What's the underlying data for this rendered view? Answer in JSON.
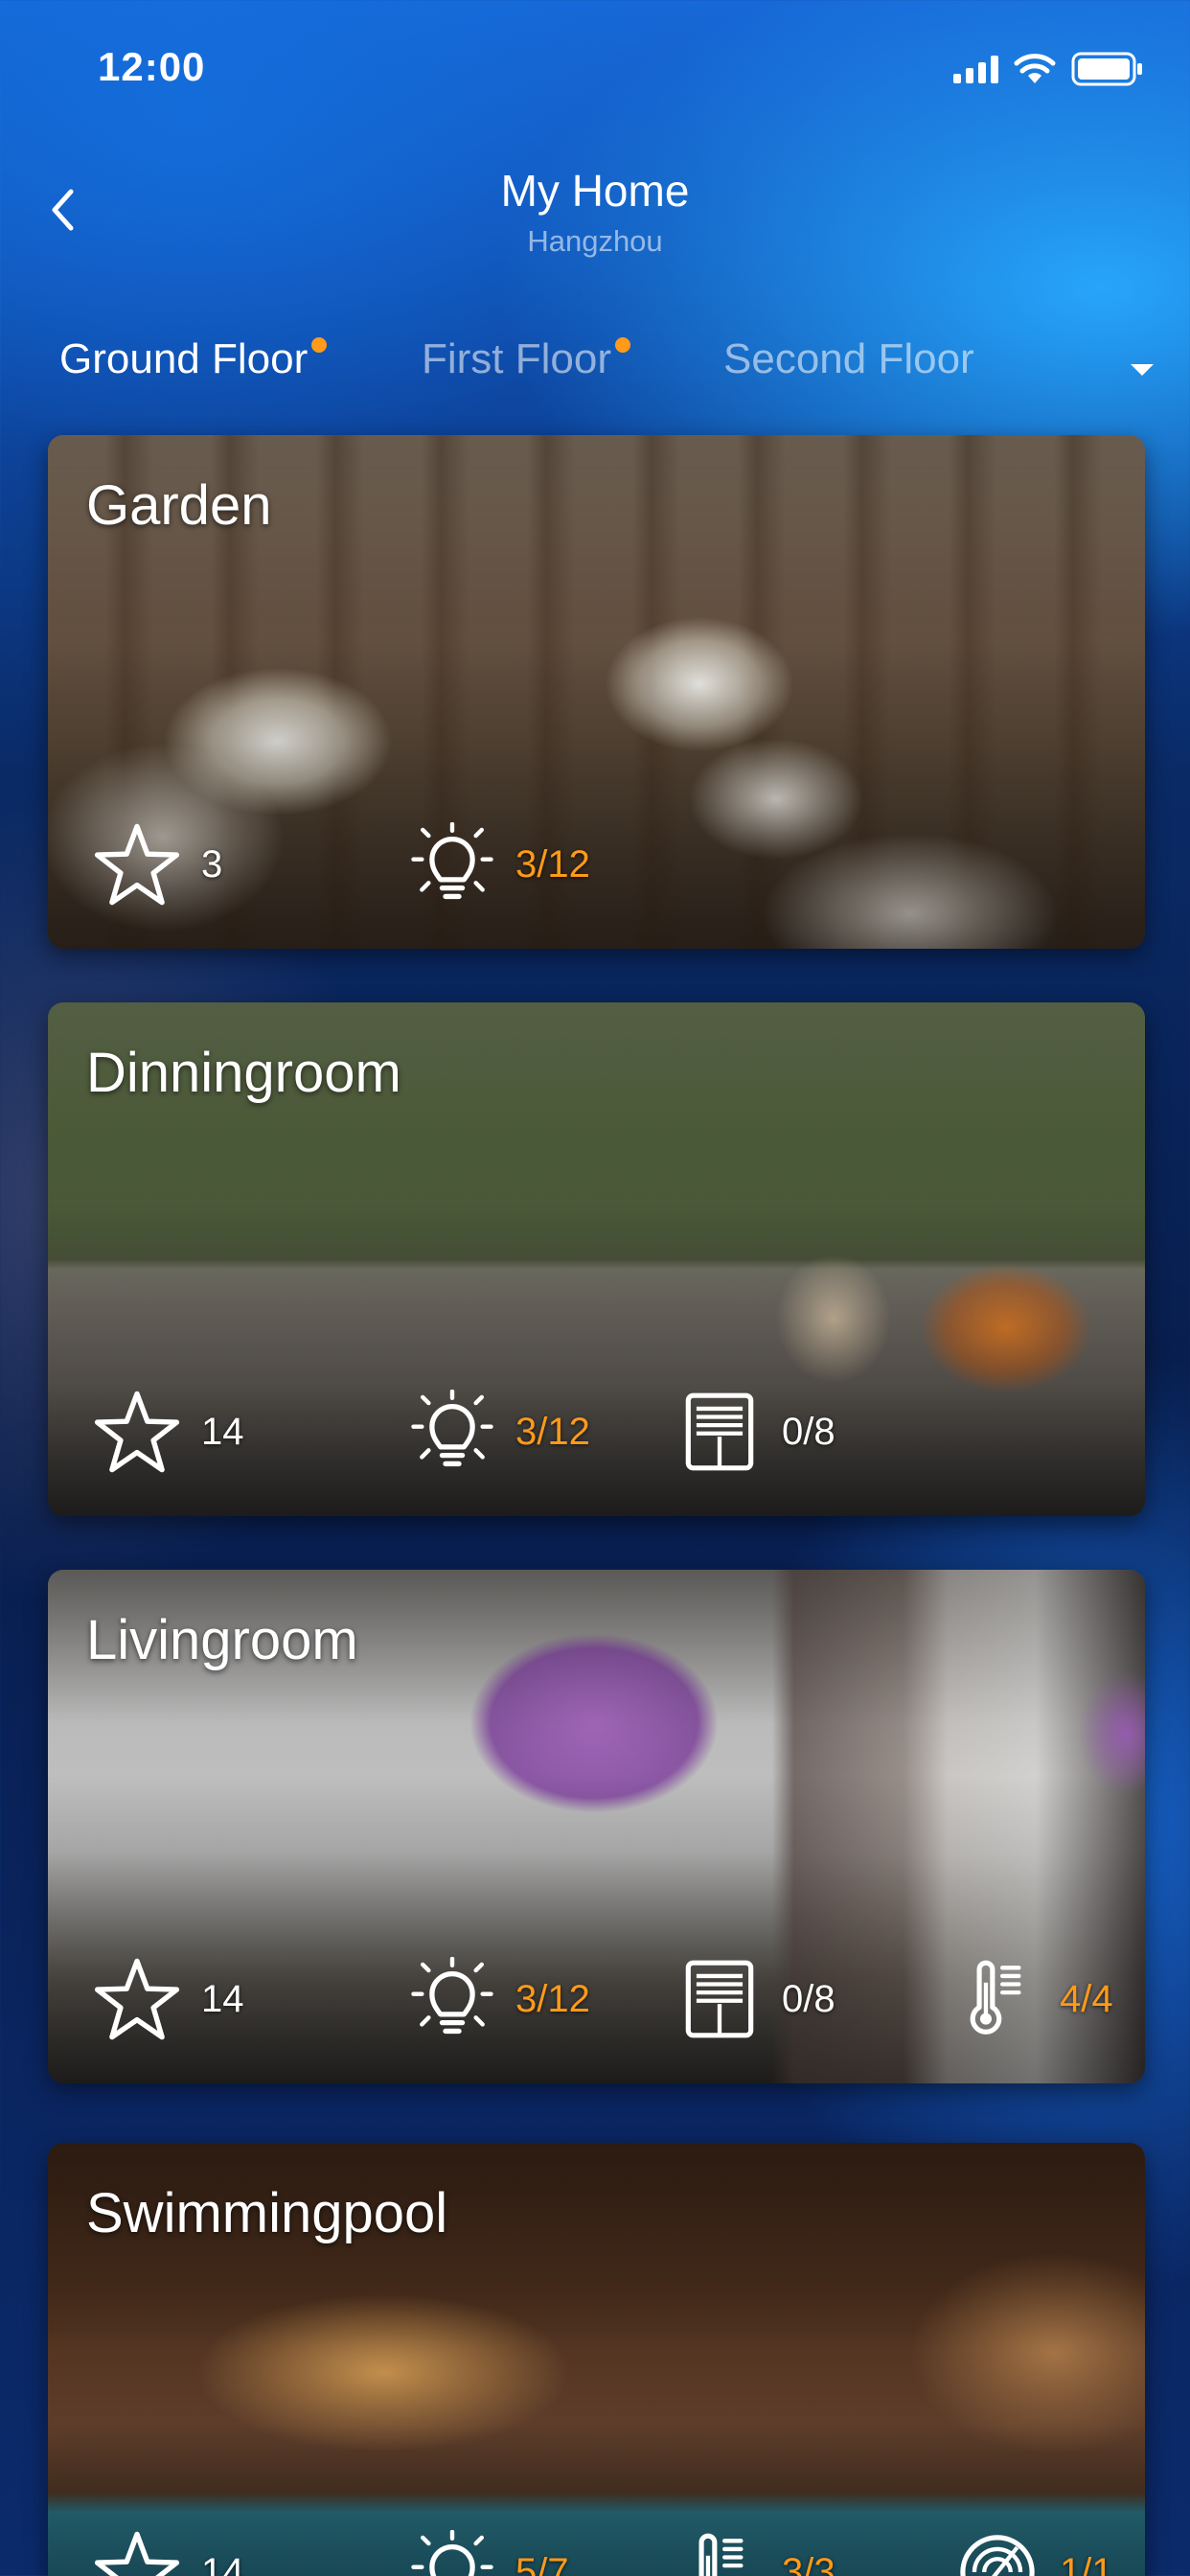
{
  "status_bar": {
    "time": "12:00"
  },
  "nav": {
    "title": "My Home",
    "subtitle": "Hangzhou"
  },
  "floor_tabs": [
    {
      "label": "Ground Floor",
      "active": true,
      "has_dot": true
    },
    {
      "label": "First Floor",
      "active": false,
      "has_dot": true
    },
    {
      "label": "Second Floor",
      "active": false,
      "has_dot": false
    }
  ],
  "colors": {
    "accent": "#ff9a1a",
    "background_top": "#1768d8",
    "background_bottom": "#0a2560"
  },
  "rooms": [
    {
      "name": "Garden",
      "favorites": "3",
      "lights": "3/12"
    },
    {
      "name": "Dinningroom",
      "favorites": "14",
      "lights": "3/12",
      "curtains": "0/8"
    },
    {
      "name": "Livingroom",
      "favorites": "14",
      "lights": "3/12",
      "curtains": "0/8",
      "temperature": "4/4"
    },
    {
      "name": "Swimmingpool",
      "favorites": "14",
      "lights": "5/7",
      "temperature": "3/3",
      "other": "1/1"
    }
  ],
  "icons": {
    "favorites": "star-icon",
    "lights": "light-bulb-icon",
    "curtains": "curtain-icon",
    "temperature": "thermometer-icon",
    "other": "sensor-icon"
  }
}
